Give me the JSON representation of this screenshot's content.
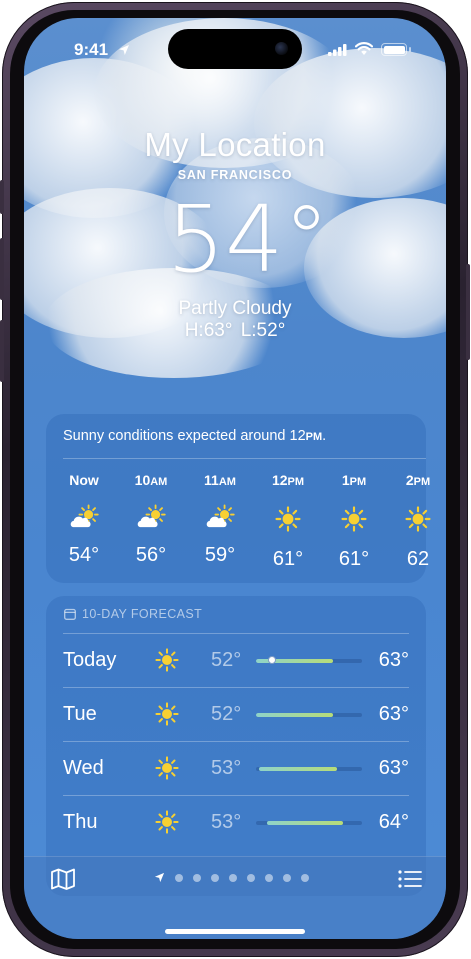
{
  "status": {
    "time": "9:41"
  },
  "header": {
    "title": "My Location",
    "subtitle": "SAN FRANCISCO",
    "temperature": "54°",
    "condition": "Partly Cloudy",
    "high_low": "H:63°  L:52°"
  },
  "hourly": {
    "summary": "Sunny conditions expected around 12PM.",
    "hours": [
      {
        "label": "Now",
        "icon": "partly-cloudy-icon",
        "temp": "54°"
      },
      {
        "label": "10AM",
        "icon": "partly-cloudy-icon",
        "temp": "56°"
      },
      {
        "label": "11AM",
        "icon": "partly-cloudy-icon",
        "temp": "59°"
      },
      {
        "label": "12PM",
        "icon": "sun-icon",
        "temp": "61°"
      },
      {
        "label": "1PM",
        "icon": "sun-icon",
        "temp": "61°"
      },
      {
        "label": "2PM",
        "icon": "sun-icon",
        "temp": "62"
      }
    ]
  },
  "daily": {
    "heading": "10-DAY FORECAST",
    "days": [
      {
        "name": "Today",
        "icon": "sun-icon",
        "low": "52°",
        "high": "63°",
        "range_start": 0.0,
        "range_end": 0.73,
        "current": 0.15
      },
      {
        "name": "Tue",
        "icon": "sun-icon",
        "low": "52°",
        "high": "63°",
        "range_start": 0.0,
        "range_end": 0.73
      },
      {
        "name": "Wed",
        "icon": "sun-icon",
        "low": "53°",
        "high": "63°",
        "range_start": 0.03,
        "range_end": 0.76
      },
      {
        "name": "Thu",
        "icon": "sun-icon",
        "low": "53°",
        "high": "64°",
        "range_start": 0.1,
        "range_end": 0.82
      }
    ]
  },
  "bottom_bar": {
    "map_icon": "map-icon",
    "list_icon": "list-icon",
    "page_count": 8,
    "current_page_icon": "location-arrow-icon"
  },
  "colors": {
    "sky_top": "#5b8fcf",
    "sky_bottom": "#4d8bd6",
    "sun": "#f7d033",
    "bar_start": "#8fd3c9",
    "bar_end": "#b7dc78"
  }
}
